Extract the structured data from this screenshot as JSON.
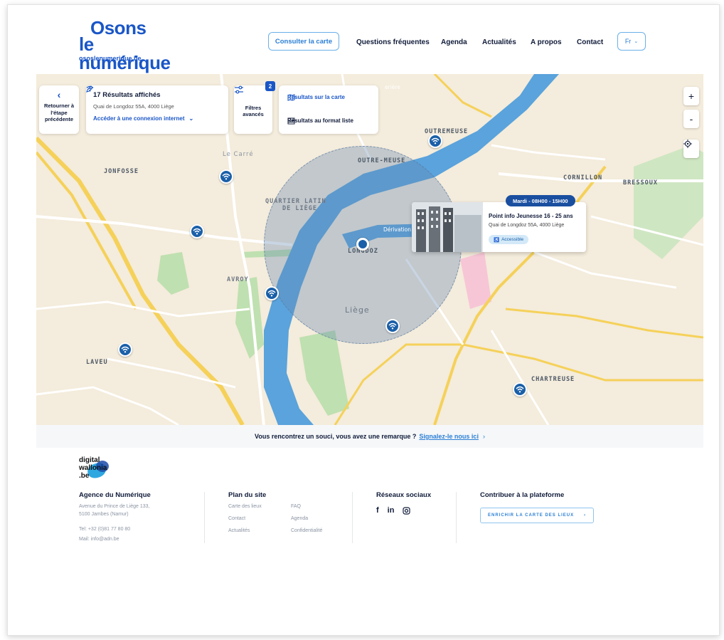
{
  "header": {
    "logo_line1": "Osons",
    "logo_line2": "le numérique",
    "logo_url": "ososlenumerique.be",
    "cta_label": "Consulter la carte",
    "nav": [
      "Questions fréquentes",
      "Agenda",
      "Actualités",
      "A propos",
      "Contact"
    ],
    "lang": "Fr"
  },
  "map_panel": {
    "back_label": "Retourner à l'étape précédente",
    "results_title": "17 Résultats affichés",
    "address": "Quai de Longdoz 55A, 4000 Liège",
    "connection_filter": "Accéder à une connexion internet",
    "filters_label": "Filtres avancés",
    "filters_count": "2",
    "view_map": "Résultats sur la carte",
    "view_list": "Résultats au format liste",
    "zoom_in": "+",
    "zoom_out": "-"
  },
  "map_labels": {
    "jonfosse": "JONFOSSE",
    "le_carre": "Le Carré",
    "quartier_latin": "QUARTIER LATIN",
    "de_liege": "DE LIÈGE",
    "outre_meuse": "OUTRE-MEUSE",
    "outremeuse": "OUTREMEUSE",
    "cornillon": "CORNILLON",
    "bressoux": "BRESSOUX",
    "avroy": "AVROY",
    "longdoz": "LONGDOZ",
    "liege": "Liège",
    "laveu": "LAVEU",
    "chartreuse": "CHARTREUSE",
    "derivation": "Dérivation",
    "meuse": "Meuse",
    "boverie": "erière"
  },
  "popup": {
    "time": "Mardi - 08H00 - 15H00",
    "title": "Point info Jeunesse 16 - 25 ans",
    "address": "Quai de Longdoz 55A, 4000 Liège",
    "accessible": "Accessible"
  },
  "report": {
    "question": "Vous rencontrez un souci, vous avez une remarque ?",
    "link": "Signalez-le nous ici"
  },
  "footer": {
    "logo_lines": [
      "digital",
      "wallonia",
      ".be"
    ],
    "agency_title": "Agence du Numérique",
    "agency_address_1": "Avenue du Prince de Liège 133,",
    "agency_address_2": "5100 Jambes (Namur)",
    "agency_tel": "Tel: +32 (0)81 77 80 80",
    "agency_mail": "Mail: info@adn.be",
    "plan_title": "Plan du site",
    "plan_links_col1": [
      "Carte des lieux",
      "Contact",
      "Actualités"
    ],
    "plan_links_col2": [
      "FAQ",
      "Agenda",
      "Confidentialité"
    ],
    "social_title": "Réseaux sociaux",
    "social_icons": [
      "facebook-icon",
      "linkedin-icon",
      "instagram-icon"
    ],
    "contribute_title": "Contribuer à la plateforme",
    "contribute_button": "ENRICHIR LA CARTE DES LIEUX"
  },
  "colors": {
    "brand_blue": "#1a56c7",
    "pin_blue": "#1a5fa8",
    "river": "#5aa3dc",
    "map_bg": "#f4ecdc"
  }
}
